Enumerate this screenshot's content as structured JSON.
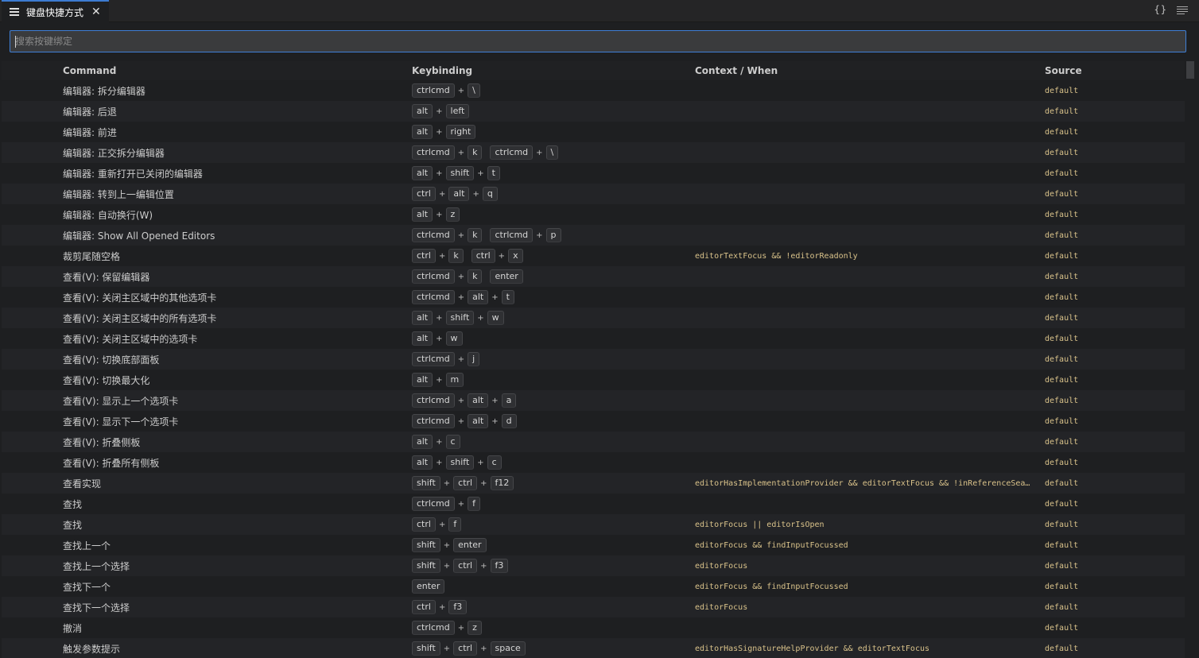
{
  "tab": {
    "title": "键盘快捷方式",
    "close": "✕"
  },
  "actions": {
    "json": "{}"
  },
  "search": {
    "placeholder": "搜索按键绑定",
    "value": ""
  },
  "columns": {
    "command": "Command",
    "keybinding": "Keybinding",
    "when": "Context / When",
    "source": "Source"
  },
  "rows": [
    {
      "command": "编辑器: 拆分编辑器",
      "keys": [
        [
          "ctrlcmd",
          "\\"
        ]
      ],
      "when": "",
      "source": "default"
    },
    {
      "command": "编辑器: 后退",
      "keys": [
        [
          "alt",
          "left"
        ]
      ],
      "when": "",
      "source": "default"
    },
    {
      "command": "编辑器: 前进",
      "keys": [
        [
          "alt",
          "right"
        ]
      ],
      "when": "",
      "source": "default"
    },
    {
      "command": "编辑器: 正交拆分编辑器",
      "keys": [
        [
          "ctrlcmd",
          "k"
        ],
        [
          "ctrlcmd",
          "\\"
        ]
      ],
      "when": "",
      "source": "default"
    },
    {
      "command": "编辑器: 重新打开已关闭的编辑器",
      "keys": [
        [
          "alt",
          "shift",
          "t"
        ]
      ],
      "when": "",
      "source": "default"
    },
    {
      "command": "编辑器: 转到上一编辑位置",
      "keys": [
        [
          "ctrl",
          "alt",
          "q"
        ]
      ],
      "when": "",
      "source": "default"
    },
    {
      "command": "编辑器: 自动换行(W)",
      "keys": [
        [
          "alt",
          "z"
        ]
      ],
      "when": "",
      "source": "default"
    },
    {
      "command": "编辑器: Show All Opened Editors",
      "keys": [
        [
          "ctrlcmd",
          "k"
        ],
        [
          "ctrlcmd",
          "p"
        ]
      ],
      "when": "",
      "source": "default"
    },
    {
      "command": "裁剪尾随空格",
      "keys": [
        [
          "ctrl",
          "k"
        ],
        [
          "ctrl",
          "x"
        ]
      ],
      "when": "editorTextFocus && !editorReadonly",
      "source": "default"
    },
    {
      "command": "查看(V): 保留编辑器",
      "keys": [
        [
          "ctrlcmd",
          "k"
        ],
        [
          "enter"
        ]
      ],
      "when": "",
      "source": "default"
    },
    {
      "command": "查看(V): 关闭主区域中的其他选项卡",
      "keys": [
        [
          "ctrlcmd",
          "alt",
          "t"
        ]
      ],
      "when": "",
      "source": "default"
    },
    {
      "command": "查看(V): 关闭主区域中的所有选项卡",
      "keys": [
        [
          "alt",
          "shift",
          "w"
        ]
      ],
      "when": "",
      "source": "default"
    },
    {
      "command": "查看(V): 关闭主区域中的选项卡",
      "keys": [
        [
          "alt",
          "w"
        ]
      ],
      "when": "",
      "source": "default"
    },
    {
      "command": "查看(V): 切换底部面板",
      "keys": [
        [
          "ctrlcmd",
          "j"
        ]
      ],
      "when": "",
      "source": "default"
    },
    {
      "command": "查看(V): 切换最大化",
      "keys": [
        [
          "alt",
          "m"
        ]
      ],
      "when": "",
      "source": "default"
    },
    {
      "command": "查看(V): 显示上一个选项卡",
      "keys": [
        [
          "ctrlcmd",
          "alt",
          "a"
        ]
      ],
      "when": "",
      "source": "default"
    },
    {
      "command": "查看(V): 显示下一个选项卡",
      "keys": [
        [
          "ctrlcmd",
          "alt",
          "d"
        ]
      ],
      "when": "",
      "source": "default"
    },
    {
      "command": "查看(V): 折叠侧板",
      "keys": [
        [
          "alt",
          "c"
        ]
      ],
      "when": "",
      "source": "default"
    },
    {
      "command": "查看(V): 折叠所有侧板",
      "keys": [
        [
          "alt",
          "shift",
          "c"
        ]
      ],
      "when": "",
      "source": "default"
    },
    {
      "command": "查看实现",
      "keys": [
        [
          "shift",
          "ctrl",
          "f12"
        ]
      ],
      "when": "editorHasImplementationProvider && editorTextFocus && !inReferenceSearchEdi...",
      "source": "default"
    },
    {
      "command": "查找",
      "keys": [
        [
          "ctrlcmd",
          "f"
        ]
      ],
      "when": "",
      "source": "default"
    },
    {
      "command": "查找",
      "keys": [
        [
          "ctrl",
          "f"
        ]
      ],
      "when": "editorFocus || editorIsOpen",
      "source": "default"
    },
    {
      "command": "查找上一个",
      "keys": [
        [
          "shift",
          "enter"
        ]
      ],
      "when": "editorFocus && findInputFocussed",
      "source": "default"
    },
    {
      "command": "查找上一个选择",
      "keys": [
        [
          "shift",
          "ctrl",
          "f3"
        ]
      ],
      "when": "editorFocus",
      "source": "default"
    },
    {
      "command": "查找下一个",
      "keys": [
        [
          "enter"
        ]
      ],
      "when": "editorFocus && findInputFocussed",
      "source": "default"
    },
    {
      "command": "查找下一个选择",
      "keys": [
        [
          "ctrl",
          "f3"
        ]
      ],
      "when": "editorFocus",
      "source": "default"
    },
    {
      "command": "撤消",
      "keys": [
        [
          "ctrlcmd",
          "z"
        ]
      ],
      "when": "",
      "source": "default"
    },
    {
      "command": "触发参数提示",
      "keys": [
        [
          "shift",
          "ctrl",
          "space"
        ]
      ],
      "when": "editorHasSignatureHelpProvider && editorTextFocus",
      "source": "default"
    }
  ]
}
